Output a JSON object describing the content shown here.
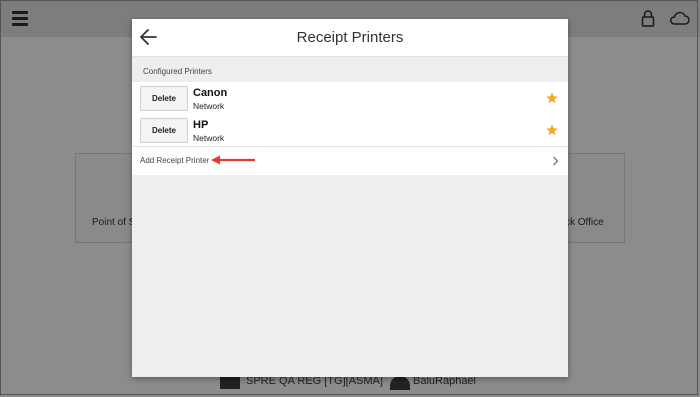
{
  "background": {
    "left_tile_label": "Point of S",
    "right_tile_label": "ck Office",
    "footer_store": "SPRE QA REG [TG][ASMA]",
    "footer_user": "BaluRaphael"
  },
  "modal": {
    "title": "Receipt Printers",
    "section_label": "Configured Printers",
    "printers": [
      {
        "delete_label": "Delete",
        "name": "Canon",
        "type": "Network",
        "favorite": true
      },
      {
        "delete_label": "Delete",
        "name": "HP",
        "type": "Network",
        "favorite": true
      }
    ],
    "add_label": "Add Receipt Printer"
  },
  "colors": {
    "star": "#f5a623",
    "annotation_arrow": "#e53935"
  },
  "icons": [
    "menu-icon",
    "lock-icon",
    "cloud-icon",
    "back-arrow-icon",
    "star-icon",
    "chevron-right-icon"
  ]
}
